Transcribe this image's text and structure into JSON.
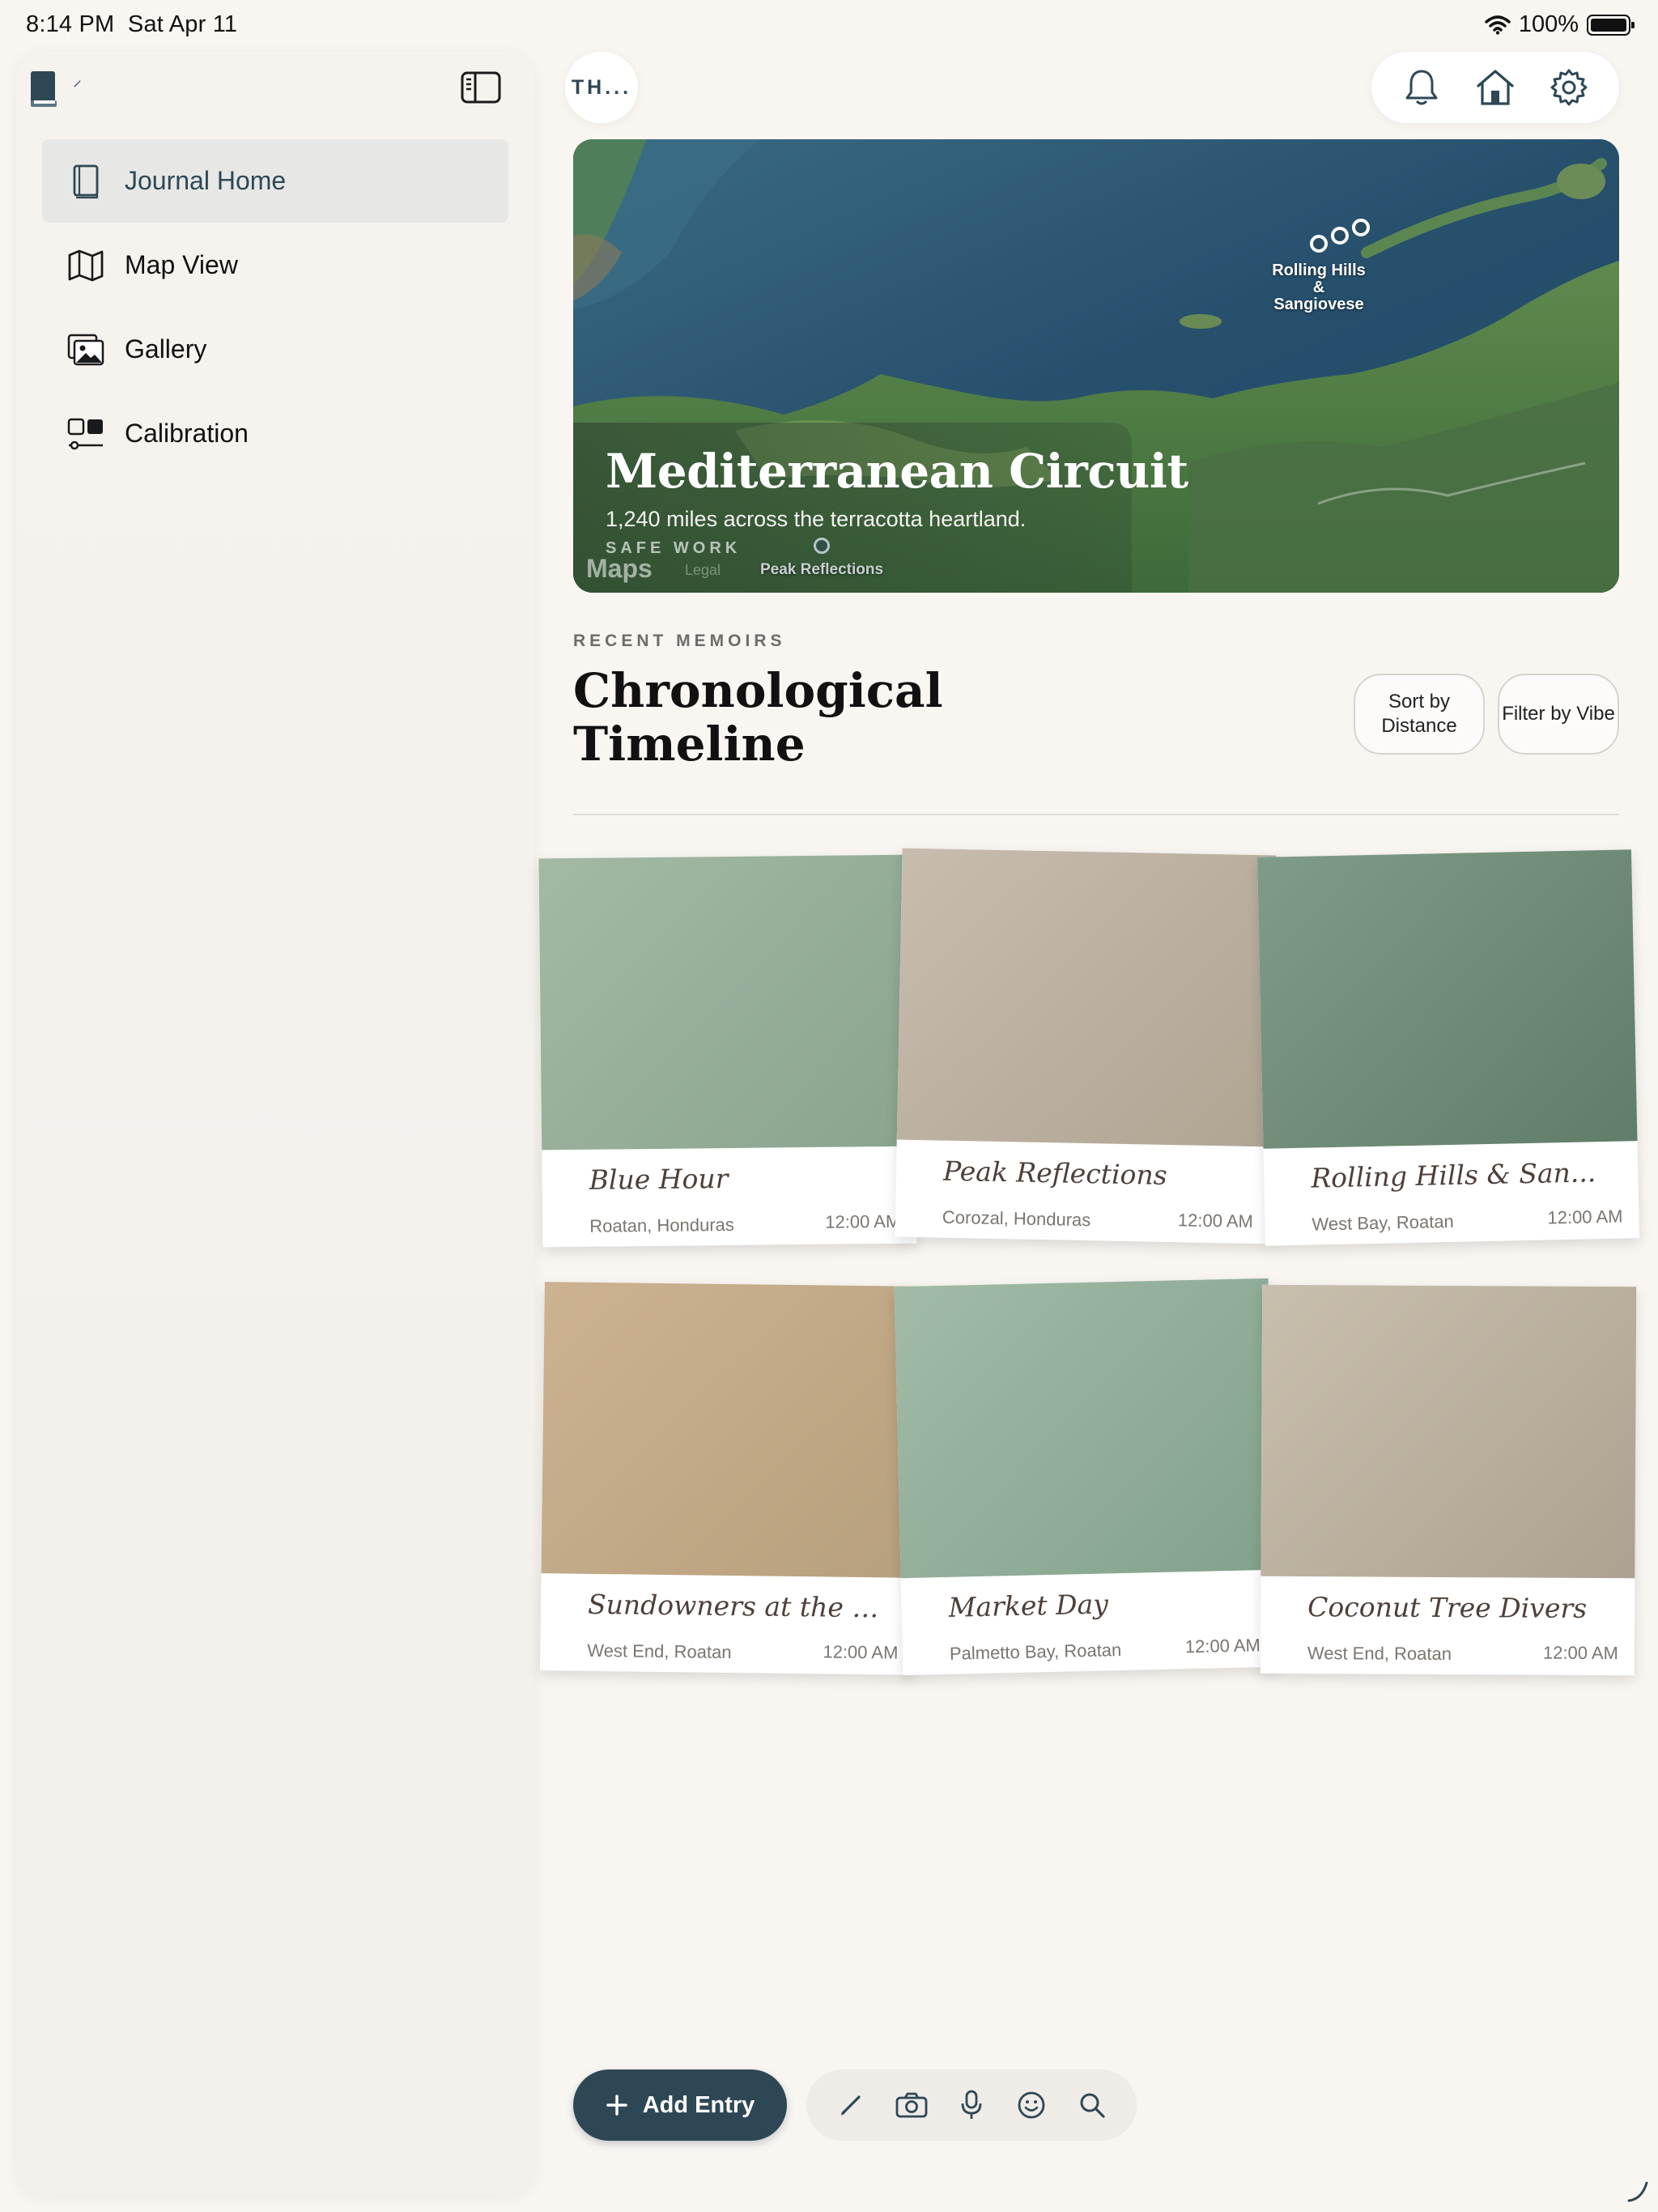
{
  "status_bar": {
    "time": "8:14 PM",
    "date": "Sat Apr 11",
    "battery": "100%"
  },
  "sidebar": {
    "mini_label": "⸍",
    "items": [
      {
        "label": "Journal Home",
        "icon": "book-icon",
        "active": true
      },
      {
        "label": "Map View",
        "icon": "map-icon",
        "active": false
      },
      {
        "label": "Gallery",
        "icon": "gallery-icon",
        "active": false
      },
      {
        "label": "Calibration",
        "icon": "calibration-icon",
        "active": false
      }
    ]
  },
  "topbar": {
    "profile_pill": "TH...",
    "actions": [
      "bell-icon",
      "home-icon",
      "gear-icon"
    ]
  },
  "hero": {
    "title": "Mediterranean Circuit",
    "subtitle": "1,240 miles across the terracotta heartland.",
    "safe_label": "SAFE WORK",
    "maps_label": "Maps",
    "legal_label": "Legal",
    "pin_labels": [
      "Rolling Hills & Sangiovese",
      "Peak Reflections"
    ]
  },
  "section": {
    "eyebrow": "RECENT MEMOIRS",
    "title": "Chronological Timeline",
    "sort_button": "Sort by Distance",
    "filter_button": "Filter by Vibe"
  },
  "cards": [
    {
      "title": "Blue Hour",
      "location": "Roatan, Honduras",
      "time": "12:00 AM",
      "color": "#94ab96"
    },
    {
      "title": "Peak Reflections",
      "location": "Corozal, Honduras",
      "time": "12:00 AM",
      "color": "#b8ad9d"
    },
    {
      "title": "Rolling Hills & San...",
      "location": "West Bay, Roatan",
      "time": "12:00 AM",
      "color": "#6d8d78"
    },
    {
      "title": "Sundowners at the H...",
      "location": "West End, Roatan",
      "time": "12:00 AM",
      "color": "#c2a987"
    },
    {
      "title": "Market Day",
      "location": "Palmetto Bay, Roatan",
      "time": "12:00 AM",
      "color": "#8fae98"
    },
    {
      "title": "Coconut Tree Divers",
      "location": "West End, Roatan",
      "time": "12:00 AM",
      "color": "#b9b0a0"
    }
  ],
  "bottom_bar": {
    "add_label": "Add Entry",
    "tools": [
      "pencil-icon",
      "camera-icon",
      "microphone-icon",
      "smiley-icon",
      "search-icon"
    ]
  },
  "colors": {
    "accent": "#2e4755",
    "background": "#f9f6f2"
  }
}
